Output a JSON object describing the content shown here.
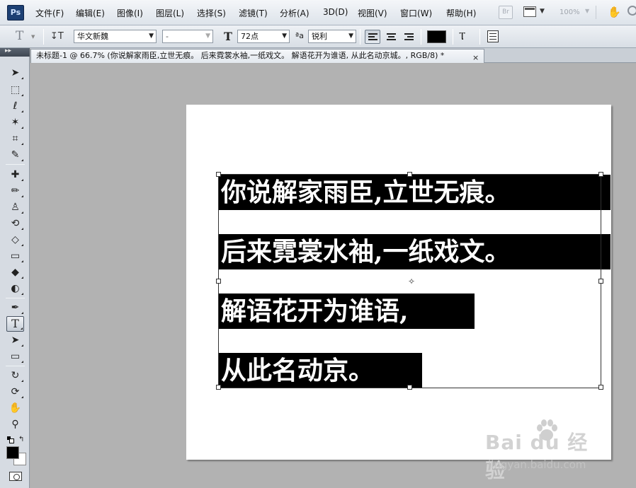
{
  "app": {
    "logo": "Ps",
    "menu": [
      "文件(F)",
      "编辑(E)",
      "图像(I)",
      "图层(L)",
      "选择(S)",
      "滤镜(T)",
      "分析(A)",
      "3D(D)",
      "视图(V)",
      "窗口(W)",
      "帮助(H)"
    ],
    "bridge_label": "Br",
    "zoom_level": "100%"
  },
  "options": {
    "font_family": "华文新魏",
    "font_style": "-",
    "font_size": "72点",
    "antialias_label": "a",
    "antialias": "锐利",
    "text_color": "#000000"
  },
  "document": {
    "tab_title": "未标题-1 @ 66.7% (你说解家雨臣,立世无痕。 后来霓裳水袖,一纸戏文。 解语花开为谁语, 从此名动京城。, RGB/8) *",
    "close_label": "×",
    "lines": [
      "你说解家雨臣,立世无痕。",
      "后来霓裳水袖,一纸戏文。",
      "解语花开为谁语,",
      "从此名动京。"
    ]
  },
  "watermark": {
    "logo": "Bai  du 经验",
    "url": "jingyan.baidu.com"
  }
}
